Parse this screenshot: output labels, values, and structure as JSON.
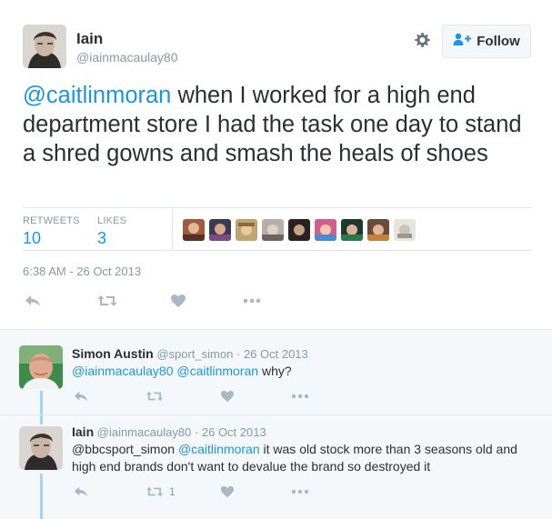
{
  "author": {
    "name": "Iain",
    "handle": "@iainmacaulay80"
  },
  "follow_button": {
    "label": "Follow"
  },
  "tweet": {
    "mention": "@caitlinmoran",
    "text": " when I worked for a high end department store I had the task one day to stand a shred gowns and smash the heals of shoes",
    "timestamp": "6:38 AM - 26 Oct 2013"
  },
  "stats": {
    "retweets_label": "RETWEETS",
    "retweets": "10",
    "likes_label": "LIKES",
    "likes": "3"
  },
  "colors": {
    "link": "#1b95e0",
    "muted": "#8899a6",
    "text": "#292f33",
    "thread_line": "#a6d4f2",
    "border": "#e1e8ed"
  },
  "icons": [
    "gear-icon",
    "follow-person-plus-icon",
    "reply-icon",
    "retweet-icon",
    "like-heart-icon",
    "more-dots-icon"
  ],
  "replies": [
    {
      "name": "Simon Austin",
      "handle": "@sport_simon",
      "separator": "·",
      "date": "26 Oct 2013",
      "mention1": "@iainmacaulay80",
      "mention2": "@caitlinmoran",
      "text": " why?",
      "retweet_count": ""
    },
    {
      "name": "Iain",
      "handle": "@iainmacaulay80",
      "separator": "·",
      "date": "26 Oct 2013",
      "mention1": "@bbcsport_simon",
      "mention2": "@caitlinmoran",
      "text": " it was old stock more than 3 seasons old and high end brands don't want to devalue the brand so destroyed it",
      "retweet_count": "1"
    }
  ]
}
